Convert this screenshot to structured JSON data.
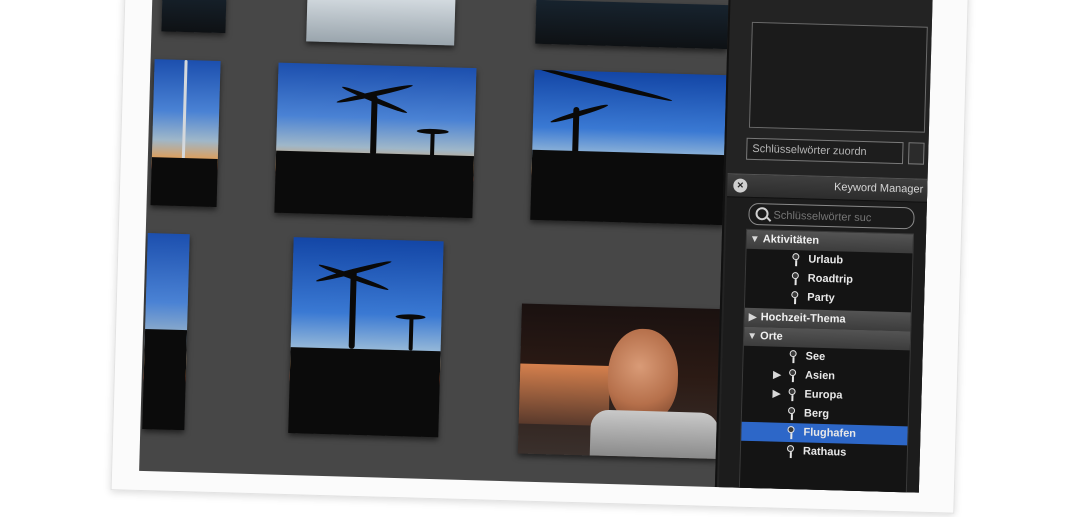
{
  "inspector": {
    "assign_placeholder": "Schlüsselwörter zuordn"
  },
  "keyword_manager": {
    "title": "Keyword Manager",
    "close_label": "×",
    "search_placeholder": "Schlüsselwörter suc",
    "groups": [
      {
        "label": "Aktivitäten",
        "expanded": true,
        "items": [
          "Urlaub",
          "Roadtrip",
          "Party"
        ]
      },
      {
        "label": "Hochzeit-Thema",
        "expanded": false,
        "items": []
      },
      {
        "label": "Orte",
        "expanded": true,
        "items": [
          "See",
          "Asien",
          "Europa",
          "Berg",
          "Flughafen",
          "Rathaus"
        ]
      }
    ],
    "selected_item": "Flughafen"
  },
  "colors": {
    "selection": "#2d67c8",
    "canvas": "#474747",
    "panel": "#232323"
  },
  "icons": [
    "close-icon",
    "search-icon",
    "disclosure-triangle-icon",
    "keyword-icon"
  ]
}
